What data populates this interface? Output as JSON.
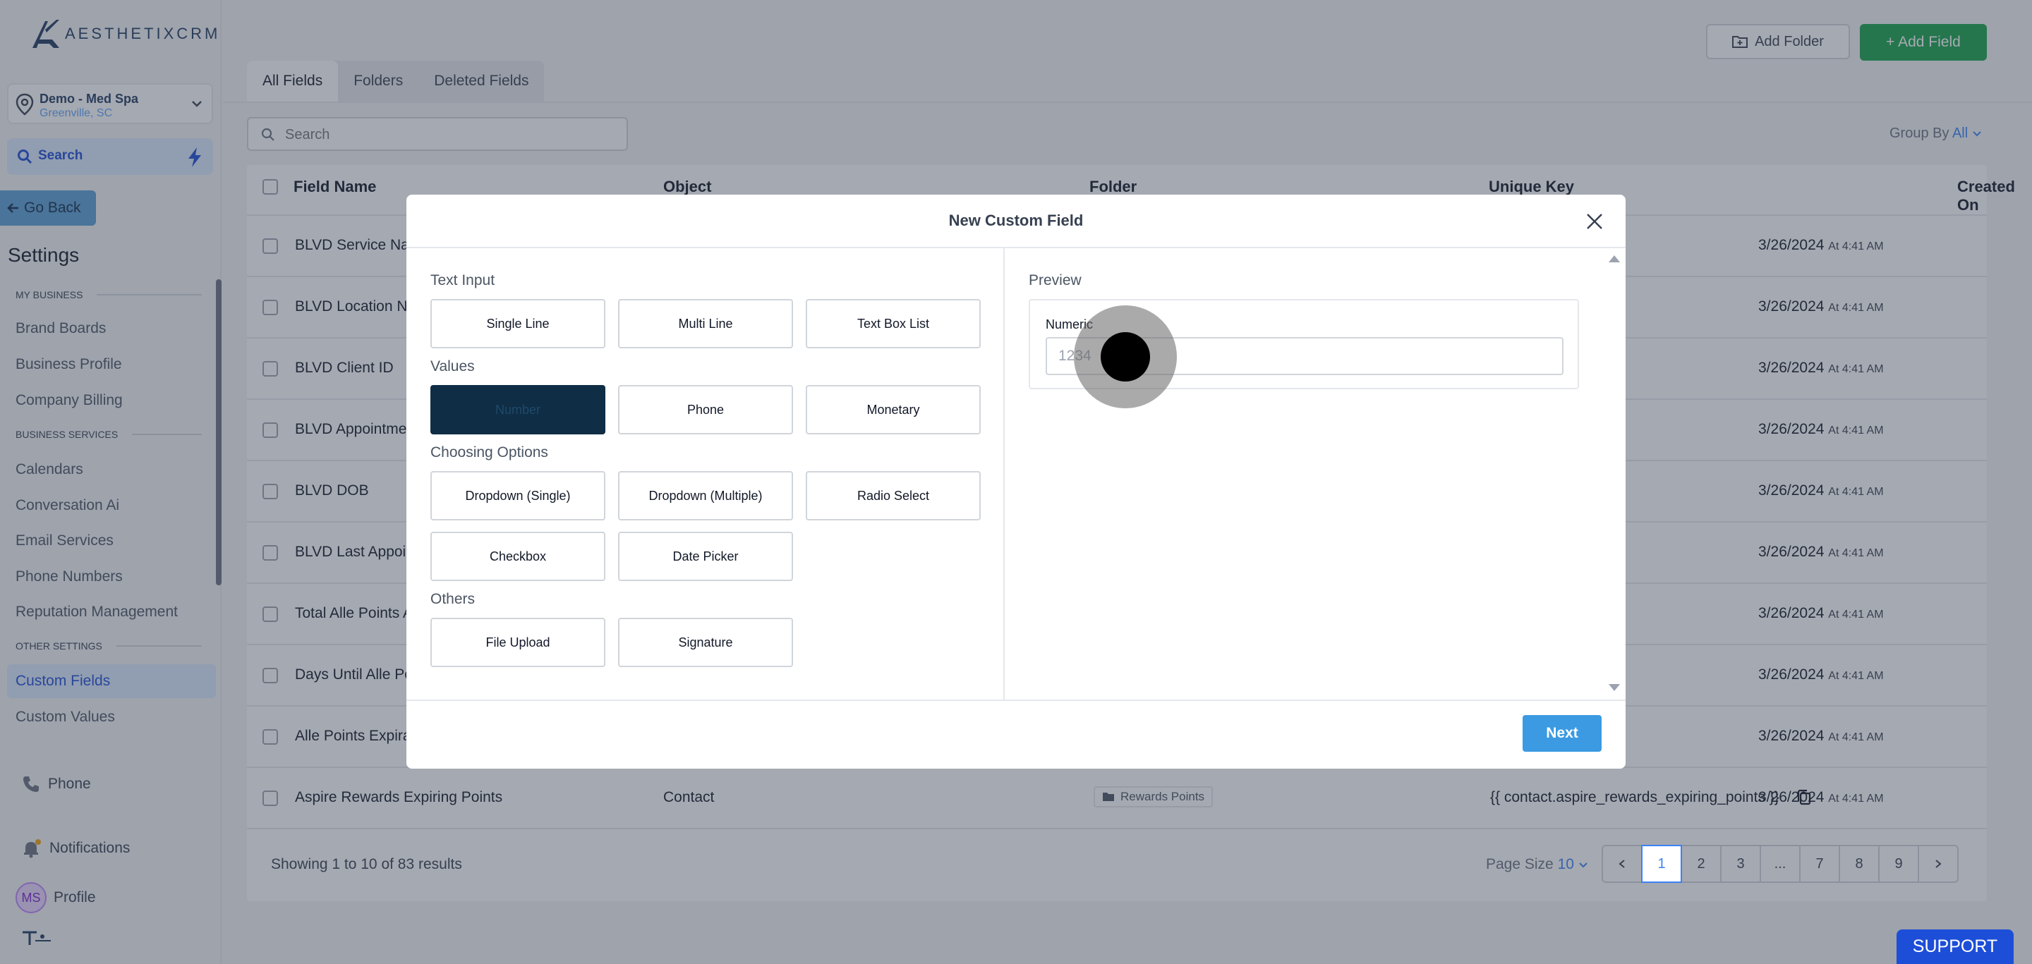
{
  "brand": {
    "name_bold": "AESTHETIX",
    "name_light": "CRM"
  },
  "location": {
    "name": "Demo - Med Spa",
    "city": "Greenville, SC"
  },
  "sidebar": {
    "search_label": "Search",
    "go_back": "Go Back",
    "settings_title": "Settings",
    "sections": {
      "my_business": "MY BUSINESS",
      "business_services": "BUSINESS SERVICES",
      "other_settings": "OTHER SETTINGS"
    },
    "my_business_items": [
      "Brand Boards",
      "Business Profile",
      "Company Billing"
    ],
    "business_services_items": [
      "Calendars",
      "Conversation Ai",
      "Email Services",
      "Phone Numbers",
      "Reputation Management"
    ],
    "other_settings_items": [
      "Custom Fields",
      "Custom Values"
    ],
    "bottom": {
      "phone": "Phone",
      "notifications": "Notifications",
      "profile": "Profile",
      "avatar_initials": "MS"
    }
  },
  "toolbar": {
    "add_folder": "Add Folder",
    "add_field": "+ Add Field"
  },
  "tabs": [
    "All Fields",
    "Folders",
    "Deleted Fields"
  ],
  "search": {
    "placeholder": "Search"
  },
  "group_by": {
    "label": "Group By",
    "value": "All"
  },
  "table": {
    "headers": {
      "field_name": "Field Name",
      "object": "Object",
      "folder": "Folder",
      "unique_key": "Unique Key",
      "created_on": "Created On"
    },
    "rows": [
      {
        "name": "BLVD Service Na",
        "date": "3/26/2024",
        "time": "At 4:41 AM"
      },
      {
        "name": "BLVD Location N",
        "date": "3/26/2024",
        "time": "At 4:41 AM"
      },
      {
        "name": "BLVD Client ID",
        "date": "3/26/2024",
        "time": "At 4:41 AM"
      },
      {
        "name": "BLVD Appointme",
        "date": "3/26/2024",
        "time": "At 4:41 AM"
      },
      {
        "name": "BLVD DOB",
        "date": "3/26/2024",
        "time": "At 4:41 AM"
      },
      {
        "name": "BLVD Last Appoi",
        "date": "3/26/2024",
        "time": "At 4:41 AM"
      },
      {
        "name": "Total Alle Points A",
        "date": "3/26/2024",
        "time": "At 4:41 AM"
      },
      {
        "name": "Days Until Alle Po",
        "date": "3/26/2024",
        "time": "At 4:41 AM"
      },
      {
        "name": "Alle Points Expira",
        "date": "3/26/2024",
        "time": "At 4:41 AM"
      },
      {
        "name": "Aspire Rewards Expiring Points",
        "object": "Contact",
        "folder": "Rewards Points",
        "key": "{{ contact.aspire_rewards_expiring_points }}",
        "date": "3/26/2024",
        "time": "At 4:41 AM"
      }
    ]
  },
  "footer": {
    "showing": "Showing 1 to 10 of 83 results",
    "page_size_label": "Page Size",
    "page_size_value": "10",
    "pages": [
      "1",
      "2",
      "3",
      "...",
      "7",
      "8",
      "9"
    ]
  },
  "modal": {
    "title": "New Custom Field",
    "groups": {
      "text_input": "Text Input",
      "values": "Values",
      "choosing": "Choosing Options",
      "others": "Others"
    },
    "types": {
      "single_line": "Single Line",
      "multi_line": "Multi Line",
      "text_box_list": "Text Box List",
      "number": "Number",
      "phone": "Phone",
      "monetary": "Monetary",
      "dropdown_single": "Dropdown (Single)",
      "dropdown_multiple": "Dropdown (Multiple)",
      "radio_select": "Radio Select",
      "checkbox": "Checkbox",
      "date_picker": "Date Picker",
      "file_upload": "File Upload",
      "signature": "Signature"
    },
    "preview": {
      "label": "Preview",
      "field_label": "Numeric",
      "placeholder": "1234"
    },
    "next": "Next"
  },
  "support": "SUPPORT"
}
